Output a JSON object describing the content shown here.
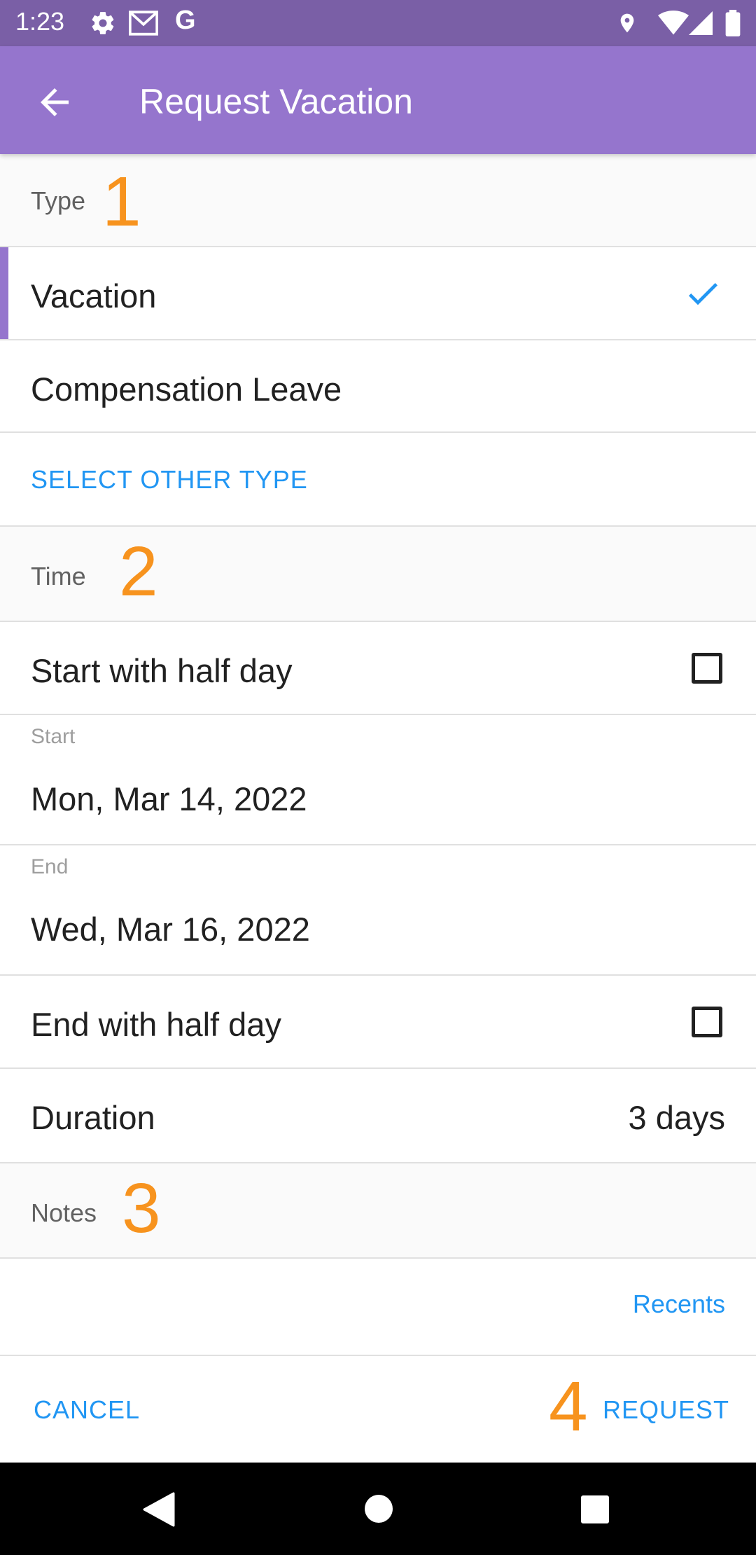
{
  "status_bar": {
    "time": "1:23",
    "left_icons": [
      "gear-icon",
      "gmail-icon",
      "google-icon"
    ],
    "right_icons": [
      "location-icon",
      "wifi-icon",
      "signal-icon",
      "battery-icon"
    ]
  },
  "app_bar": {
    "back_icon": "arrow-left-icon",
    "title": "Request Vacation",
    "color": "#9575cd"
  },
  "sections": {
    "type": {
      "label": "Type",
      "step": "1"
    },
    "time": {
      "label": "Time",
      "step": "2"
    },
    "notes": {
      "label": "Notes",
      "step": "3"
    }
  },
  "type_options": [
    {
      "label": "Vacation",
      "selected": true
    },
    {
      "label": "Compensation Leave",
      "selected": false
    }
  ],
  "select_other_type": "SELECT OTHER TYPE",
  "time": {
    "start_half_day": {
      "label": "Start with half day",
      "checked": false
    },
    "start": {
      "label": "Start",
      "value": "Mon, Mar 14, 2022"
    },
    "end": {
      "label": "End",
      "value": "Wed, Mar 16, 2022"
    },
    "end_half_day": {
      "label": "End with half day",
      "checked": false
    },
    "duration": {
      "label": "Duration",
      "value": "3 days"
    }
  },
  "notes": {
    "recents": "Recents"
  },
  "actions": {
    "cancel": "CANCEL",
    "request": "REQUEST",
    "step": "4"
  },
  "nav_bar": {
    "icons": [
      "back-triangle-icon",
      "home-circle-icon",
      "recents-square-icon"
    ]
  },
  "colors": {
    "accent": "#2196f3",
    "step_number": "#f7931e",
    "status_bar": "#7a5fa6"
  }
}
